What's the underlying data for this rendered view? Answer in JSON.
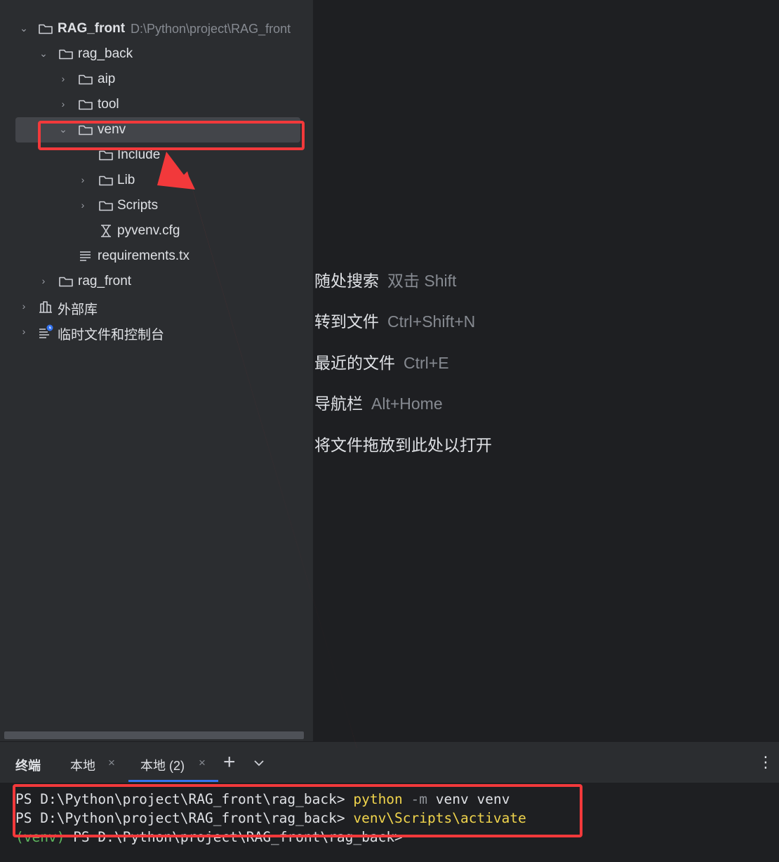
{
  "project_tree": {
    "root": {
      "label": "RAG_front",
      "path": "D:\\Python\\project\\RAG_front"
    },
    "rag_back": "rag_back",
    "aip": "aip",
    "tool": "tool",
    "venv": "venv",
    "include": "Include",
    "lib": "Lib",
    "scripts": "Scripts",
    "pyvenv": "pyvenv.cfg",
    "requirements": "requirements.tx",
    "rag_front": "rag_front",
    "external_libs": "外部库",
    "scratches": "临时文件和控制台"
  },
  "editor_hints": [
    {
      "label": "随处搜索",
      "shortcut": "双击 Shift"
    },
    {
      "label": "转到文件",
      "shortcut": "Ctrl+Shift+N"
    },
    {
      "label": "最近的文件",
      "shortcut": "Ctrl+E"
    },
    {
      "label": "导航栏",
      "shortcut": "Alt+Home"
    },
    {
      "label": "将文件拖放到此处以打开",
      "shortcut": ""
    }
  ],
  "terminal_bar": {
    "title": "终端",
    "tab1": "本地",
    "tab2": "本地 (2)",
    "close": "×",
    "add": "+",
    "more": "⋮"
  },
  "terminal": {
    "prompt": "PS D:\\Python\\project\\RAG_front\\rag_back> ",
    "line1": {
      "cmd": "python",
      "flag": "-m",
      "args": "venv venv"
    },
    "line2": {
      "cmd": "venv\\Scripts\\activate"
    },
    "line3": {
      "env": "(venv)",
      "text": " PS D:\\Python\\project\\RAG_front\\rag_back>"
    }
  },
  "colors": {
    "annotation": "#f2393b",
    "accent": "#3574f0",
    "command": "#f0d44c",
    "venv": "#5fb95f"
  }
}
